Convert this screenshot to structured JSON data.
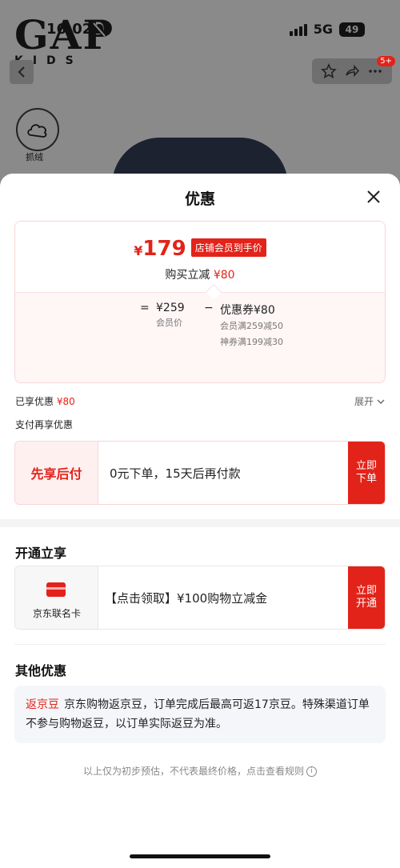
{
  "background": {
    "brand": {
      "line1": "GAP",
      "line2": "KIDS"
    },
    "status_bar": {
      "time": "16:02",
      "network": "5G",
      "battery": "49"
    },
    "badge": "5+",
    "feature_label": "抓绒"
  },
  "sheet": {
    "title": "优惠",
    "price_card": {
      "currency": "¥",
      "price": "179",
      "member_tag": "店铺会员到手价",
      "instant_label": "购买立减",
      "instant_amount": "¥80",
      "equals": "=",
      "member_price": "¥259",
      "member_price_label": "会员价",
      "minus": "−",
      "coupon": "优惠券¥80",
      "coupon_detail_1": "会员满259减50",
      "coupon_detail_2": "神券满199减30"
    },
    "enjoyed_label": "已享优惠",
    "enjoyed_amount": "¥80",
    "expand_label": "展开",
    "pay_more_label": "支付再享优惠",
    "bnpl": {
      "title": "先享后付",
      "text": "0元下单，15天后再付款",
      "button": "立即下单"
    },
    "open_section_title": "开通立享",
    "jd_card": {
      "label": "京东联名卡",
      "text": "【点击领取】¥100购物立减金",
      "button": "立即开通"
    },
    "other_section_title": "其他优惠",
    "other": {
      "tag": "返京豆",
      "text": "京东购物返京豆，订单完成后最高可返17京豆。特殊渠道订单不参与购物返豆，以订单实际返豆为准。"
    },
    "disclaimer": "以上仅为初步预估，不代表最终价格，点击查看规则"
  },
  "colors": {
    "accent": "#e2231a",
    "card_border": "#f6d6d6",
    "gray_band": "#f4f4f4"
  },
  "icons": [
    "close-icon",
    "chevron-down-icon",
    "info-icon",
    "bell-mute-icon",
    "star-icon",
    "share-icon",
    "more-icon",
    "back-icon",
    "card-icon"
  ]
}
